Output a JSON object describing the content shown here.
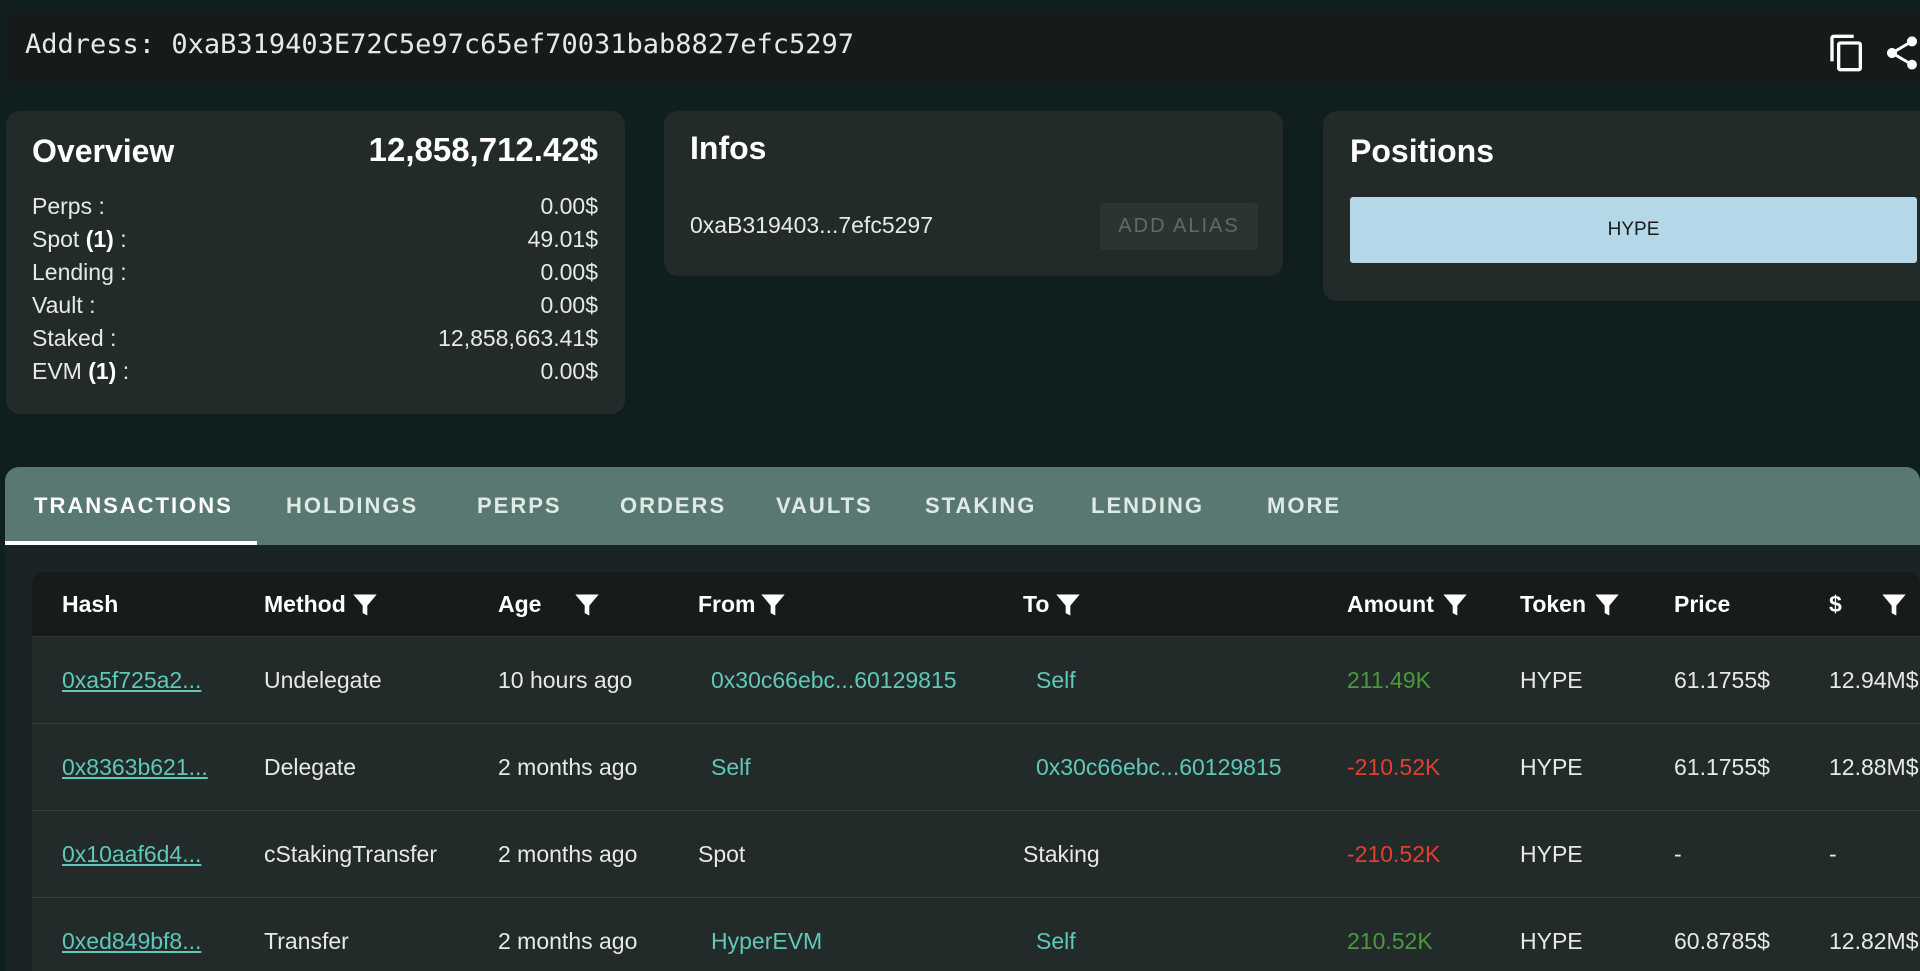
{
  "address_bar": {
    "label": "Address:",
    "address": "0xaB319403E72C5e97c65ef70031bab8827efc5297",
    "copy_icon": "copy-icon",
    "share_icon": "share-icon"
  },
  "overview": {
    "title": "Overview",
    "total": "12,858,712.42$",
    "rows": [
      {
        "label": "Perps :",
        "count": "",
        "value": "0.00$"
      },
      {
        "label": "Spot",
        "count": "(1)",
        "value": "49.01$"
      },
      {
        "label": "Lending :",
        "count": "",
        "value": "0.00$"
      },
      {
        "label": "Vault :",
        "count": "",
        "value": "0.00$"
      },
      {
        "label": "Staked :",
        "count": "",
        "value": "12,858,663.41$"
      },
      {
        "label": "EVM",
        "count": "(1)",
        "value": "0.00$"
      }
    ],
    "suffix": " :"
  },
  "infos": {
    "title": "Infos",
    "short_address": "0xaB319403...7efc5297",
    "add_alias_label": "ADD ALIAS"
  },
  "positions": {
    "title": "Positions",
    "token_label": "HYPE"
  },
  "tabs": [
    {
      "label": "TRANSACTIONS",
      "active": true
    },
    {
      "label": "HOLDINGS"
    },
    {
      "label": "PERPS"
    },
    {
      "label": "ORDERS"
    },
    {
      "label": "VAULTS"
    },
    {
      "label": "STAKING"
    },
    {
      "label": "LENDING"
    },
    {
      "label": "MORE"
    }
  ],
  "table": {
    "columns": [
      "Hash",
      "Method",
      "Age",
      "From",
      "To",
      "Amount",
      "Token",
      "Price",
      "$"
    ],
    "rows": [
      {
        "hash": "0xa5f725a2...",
        "method": "Undelegate",
        "age": "10 hours ago",
        "from": "0x30c66ebc...60129815",
        "to": "Self",
        "amount": "211.49K",
        "token": "HYPE",
        "price": "61.1755$",
        "usd": "12.94M$"
      },
      {
        "hash": "0x8363b621...",
        "method": "Delegate",
        "age": "2 months ago",
        "from": "Self",
        "to": "0x30c66ebc...60129815",
        "amount": "-210.52K",
        "token": "HYPE",
        "price": "61.1755$",
        "usd": "12.88M$"
      },
      {
        "hash": "0x10aaf6d4...",
        "method": "cStakingTransfer",
        "age": "2 months ago",
        "from": "Spot",
        "to": "Staking",
        "amount": "-210.52K",
        "token": "HYPE",
        "price": "-",
        "usd": "-"
      },
      {
        "hash": "0xed849bf8...",
        "method": "Transfer",
        "age": "2 months ago",
        "from": "HyperEVM",
        "to": "Self",
        "amount": "210.52K",
        "token": "HYPE",
        "price": "60.8785$",
        "usd": "12.82M$"
      }
    ]
  },
  "colors": {
    "background": "#0e1f1d",
    "card": "#232a2a",
    "tab_bar": "#5a7872",
    "link": "#5fc8b8",
    "positive": "#4a9a3c",
    "negative": "#e0402e",
    "hype_button": "#b5d8e8"
  }
}
